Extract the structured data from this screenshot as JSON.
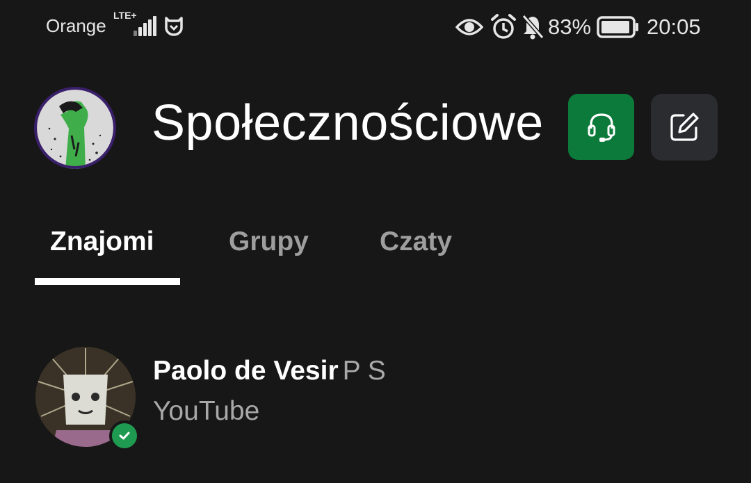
{
  "status_bar": {
    "carrier": "Orange",
    "network": "LTE+",
    "battery": "83%",
    "time": "20:05"
  },
  "header": {
    "title": "Społecznościowe"
  },
  "tabs": [
    {
      "label": "Znajomi",
      "active": true
    },
    {
      "label": "Grupy",
      "active": false
    },
    {
      "label": "Czaty",
      "active": false
    }
  ],
  "friends": [
    {
      "gamertag": "Paolo de Vesir",
      "real_name": "P S",
      "status": "YouTube",
      "online": true
    }
  ],
  "colors": {
    "background": "#171717",
    "accent_green": "#0c7a3a",
    "online_badge": "#1f9a51",
    "secondary_button": "#2b2c30",
    "inactive_tab": "#9e9e9e"
  },
  "icons": [
    "signal-icon",
    "mi-icon",
    "eye-icon",
    "alarm-icon",
    "bell-off-icon",
    "battery-icon",
    "headset-icon",
    "compose-icon",
    "check-icon"
  ]
}
